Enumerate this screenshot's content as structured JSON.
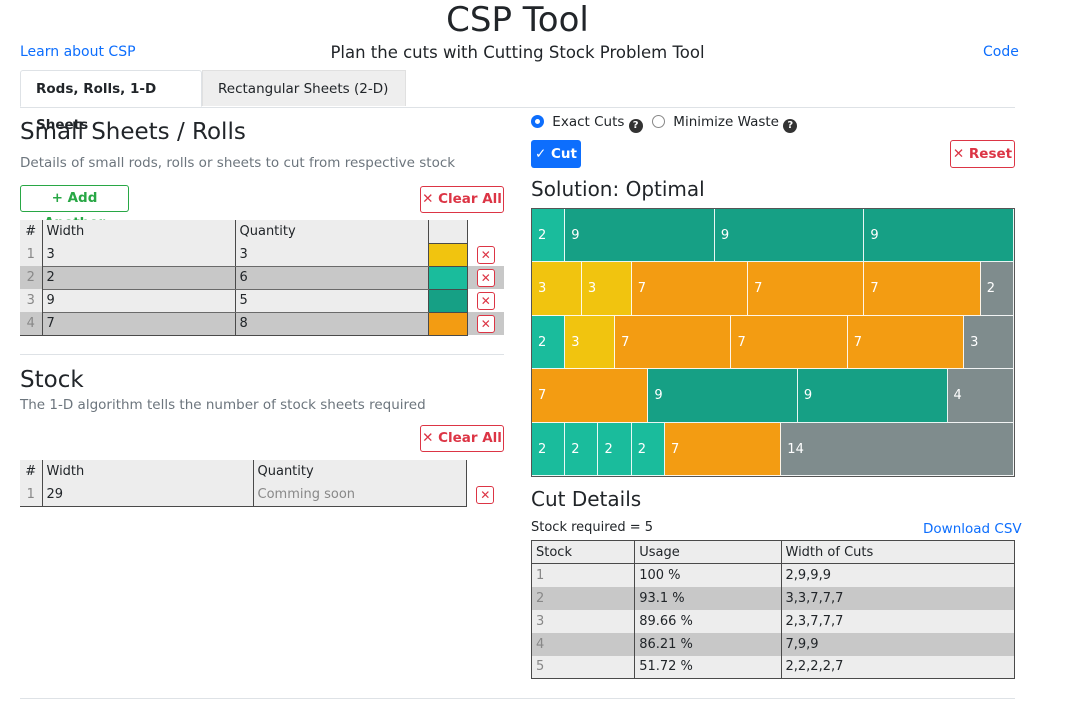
{
  "header": {
    "title": "CSP Tool",
    "subtitle": "Plan the cuts with Cutting Stock Problem Tool",
    "learn_link": "Learn about CSP",
    "code_link": "Code"
  },
  "tabs": [
    {
      "label": "Rods, Rolls, 1-D Sheets"
    },
    {
      "label": "Rectangular Sheets (2-D)"
    }
  ],
  "small_sheets": {
    "title": "Small Sheets / Rolls",
    "description": "Details of small rods, rolls or sheets to cut from respective stock",
    "add_button": "+ Add Another",
    "clear_button": "✕ Clear All",
    "columns": [
      "#",
      "Width",
      "Quantity"
    ],
    "rows": [
      {
        "index": "1",
        "width": "3",
        "quantity": "3",
        "color": "#f1c40f"
      },
      {
        "index": "2",
        "width": "2",
        "quantity": "6",
        "color": "#1abc9c"
      },
      {
        "index": "3",
        "width": "9",
        "quantity": "5",
        "color": "#16a085"
      },
      {
        "index": "4",
        "width": "7",
        "quantity": "8",
        "color": "#f39c12"
      }
    ]
  },
  "stock": {
    "title": "Stock",
    "description": "The 1-D algorithm tells the number of stock sheets required",
    "clear_button": "✕ Clear All",
    "columns": [
      "#",
      "Width",
      "Quantity"
    ],
    "rows": [
      {
        "index": "1",
        "width": "29",
        "quantity_placeholder": "Comming soon"
      }
    ]
  },
  "options": {
    "exact_cuts": "Exact Cuts",
    "minimize_waste": "Minimize Waste",
    "selected": "Exact Cuts",
    "help_icon": "?"
  },
  "actions": {
    "cut_button": "✓ Cut",
    "reset_button": "✕ Reset"
  },
  "solution": {
    "title": "Solution: Optimal",
    "stock_width": 29,
    "colors": {
      "2": "#1abc9c",
      "3": "#f1c40f",
      "7": "#f39c12",
      "9": "#16a085",
      "waste": "#7f8c8d"
    },
    "rows": [
      {
        "cuts": [
          2,
          9,
          9,
          9
        ],
        "waste": 0
      },
      {
        "cuts": [
          3,
          3,
          7,
          7,
          7
        ],
        "waste": 2
      },
      {
        "cuts": [
          2,
          3,
          7,
          7,
          7
        ],
        "waste": 3
      },
      {
        "cuts": [
          7,
          9,
          9
        ],
        "waste": 4
      },
      {
        "cuts": [
          2,
          2,
          2,
          2,
          7
        ],
        "waste": 14
      }
    ]
  },
  "cut_details": {
    "title": "Cut Details",
    "stock_required": "Stock required = 5",
    "download": "Download CSV",
    "columns": [
      "Stock",
      "Usage",
      "Width of Cuts"
    ],
    "rows": [
      {
        "stock": "1",
        "usage": "100 %",
        "widths": "2,9,9,9"
      },
      {
        "stock": "2",
        "usage": "93.1 %",
        "widths": "3,3,7,7,7"
      },
      {
        "stock": "3",
        "usage": "89.66 %",
        "widths": "2,3,7,7,7"
      },
      {
        "stock": "4",
        "usage": "86.21 %",
        "widths": "7,9,9"
      },
      {
        "stock": "5",
        "usage": "51.72 %",
        "widths": "2,2,2,2,7"
      }
    ]
  }
}
